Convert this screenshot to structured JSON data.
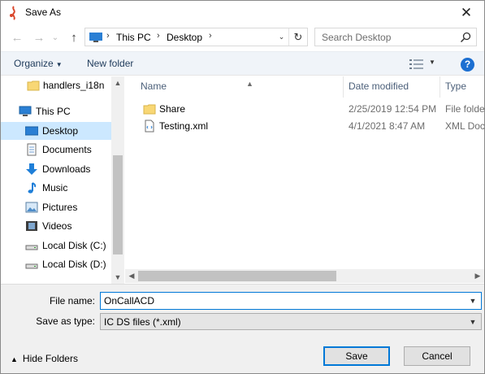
{
  "window": {
    "title": "Save As",
    "close_glyph": "✕"
  },
  "nav": {
    "back_glyph": "←",
    "forward_glyph": "→",
    "recent_glyph": "⌄",
    "up_glyph": "↑"
  },
  "address": {
    "crumbs": [
      "This PC",
      "Desktop"
    ],
    "separator": "›",
    "dropdown_glyph": "⌄",
    "refresh_glyph": "↻"
  },
  "search": {
    "placeholder": "Search Desktop"
  },
  "toolbar": {
    "organize_label": "Organize",
    "new_folder_label": "New folder",
    "help_label": "?"
  },
  "sidebar": {
    "items": [
      {
        "label": "handlers_i18n",
        "icon": "folder-icon"
      },
      {
        "label": "This PC",
        "icon": "computer-icon"
      },
      {
        "label": "Desktop",
        "icon": "desktop-icon",
        "selected": true
      },
      {
        "label": "Documents",
        "icon": "documents-icon"
      },
      {
        "label": "Downloads",
        "icon": "downloads-icon"
      },
      {
        "label": "Music",
        "icon": "music-icon"
      },
      {
        "label": "Pictures",
        "icon": "pictures-icon"
      },
      {
        "label": "Videos",
        "icon": "videos-icon"
      },
      {
        "label": "Local Disk (C:)",
        "icon": "drive-icon"
      },
      {
        "label": "Local Disk (D:)",
        "icon": "drive-icon"
      }
    ]
  },
  "file_list": {
    "columns": [
      "Name",
      "Date modified",
      "Type"
    ],
    "rows": [
      {
        "name": "Share",
        "date": "2/25/2019 12:54 PM",
        "type": "File folder",
        "icon": "folder-icon"
      },
      {
        "name": "Testing.xml",
        "date": "4/1/2021 8:47 AM",
        "type": "XML Docu",
        "icon": "xml-file-icon"
      }
    ]
  },
  "form": {
    "file_name_label": "File name:",
    "file_name_value": "OnCallACD",
    "save_type_label": "Save as type:",
    "save_type_value": "IC DS files (*.xml)",
    "hide_folders_label": "Hide Folders",
    "save_label": "Save",
    "cancel_label": "Cancel"
  },
  "colors": {
    "selected_bg": "#cce8ff",
    "accent": "#0078d7",
    "folder": "#f8d775",
    "toolbar_bg": "#f0f4f9"
  }
}
